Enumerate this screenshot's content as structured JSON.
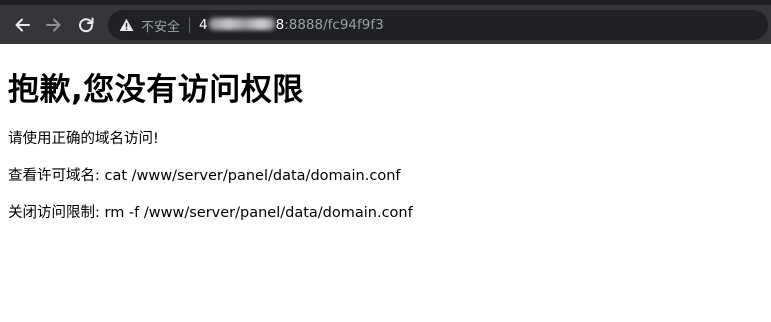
{
  "browser": {
    "security_label": "不安全",
    "url_host_start": "4",
    "url_host_end": "8",
    "url_path": ":8888/fc94f9f3"
  },
  "page": {
    "title": "抱歉,您没有访问权限",
    "line1": "请使用正确的域名访问!",
    "line2": "查看许可域名: cat /www/server/panel/data/domain.conf",
    "line3": "关闭访问限制: rm -f /www/server/panel/data/domain.conf"
  },
  "colors": {
    "toolbar_bg": "#35363a",
    "omnibox_bg": "#202124",
    "muted_text": "#9aa0a6"
  }
}
